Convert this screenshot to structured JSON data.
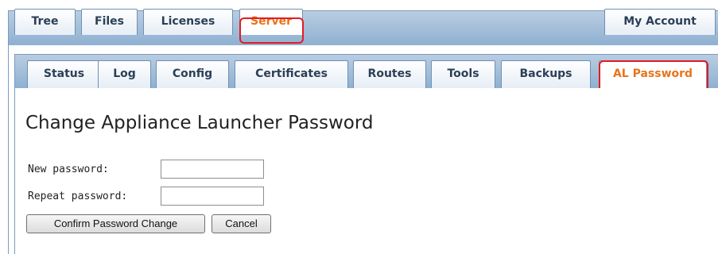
{
  "top_tabs": {
    "tree": "Tree",
    "files": "Files",
    "licenses": "Licenses",
    "server": "Server",
    "my_account": "My Account"
  },
  "sub_tabs": {
    "status": "Status",
    "log": "Log",
    "config": "Config",
    "certificates": "Certificates",
    "routes": "Routes",
    "tools": "Tools",
    "backups": "Backups",
    "al_password": "AL Password"
  },
  "page": {
    "title": "Change Appliance Launcher Password"
  },
  "form": {
    "new_password_label": "New password:",
    "new_password_value": "",
    "repeat_password_label": "Repeat password:",
    "repeat_password_value": "",
    "confirm_button": "Confirm Password Change",
    "cancel_button": "Cancel"
  },
  "colors": {
    "active_tab_text": "#e8741a",
    "highlight_ring": "#e31b23",
    "tab_bar": "#9fbad7"
  }
}
